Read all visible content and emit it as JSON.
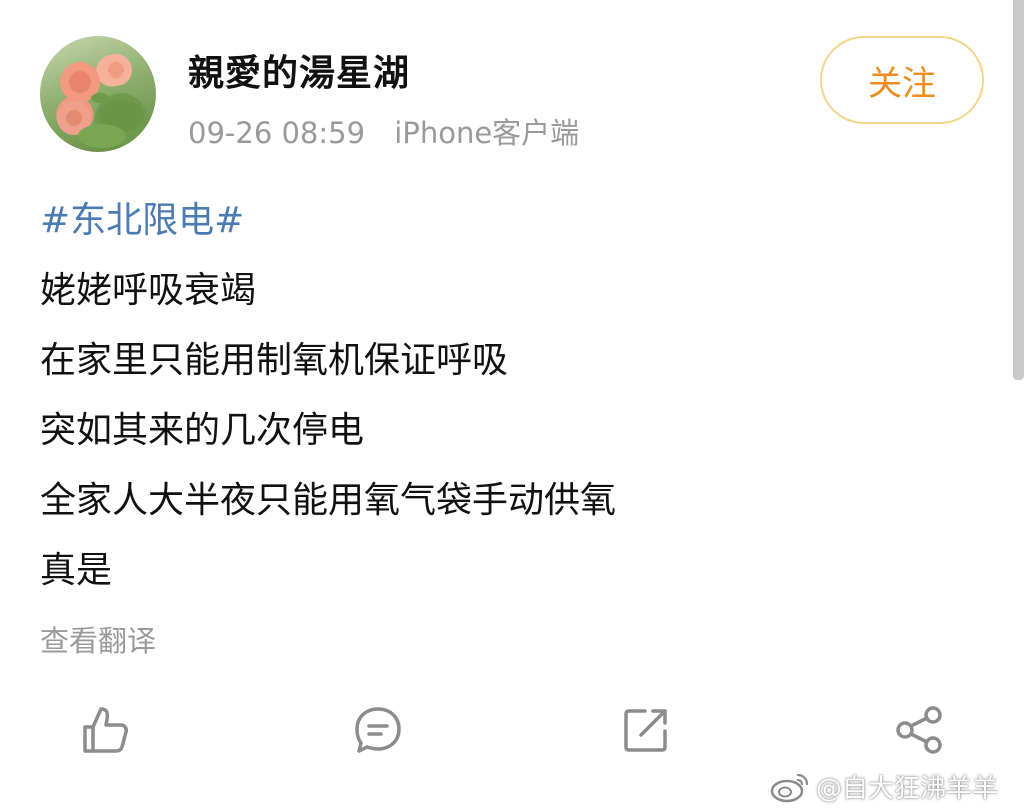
{
  "post": {
    "author": {
      "name": "親愛的湯星湖",
      "avatar": "rose-photo-avatar"
    },
    "timestamp": "09-26 08:59",
    "source": "iPhone客户端",
    "follow_label": "关注",
    "hashtag": "#东北限电#",
    "body_lines": [
      "姥姥呼吸衰竭",
      "在家里只能用制氧机保证呼吸",
      "突如其来的几次停电",
      "全家人大半夜只能用氧气袋手动供氧",
      "真是"
    ],
    "translate_label": "查看翻译",
    "actions": [
      {
        "name": "like",
        "icon": "thumbs-up-icon"
      },
      {
        "name": "comment",
        "icon": "comment-icon"
      },
      {
        "name": "repost",
        "icon": "repost-icon"
      },
      {
        "name": "share",
        "icon": "share-icon"
      }
    ]
  },
  "watermark": {
    "text": "@自大狂沸羊羊",
    "icon": "weibo-logo-icon"
  },
  "colors": {
    "hashtag": "#4c7bb3",
    "follow_text": "#ef8c1e",
    "follow_border": "#f3d58a",
    "meta_gray": "#9a9a9a",
    "icon_gray": "#8c8c8c"
  }
}
